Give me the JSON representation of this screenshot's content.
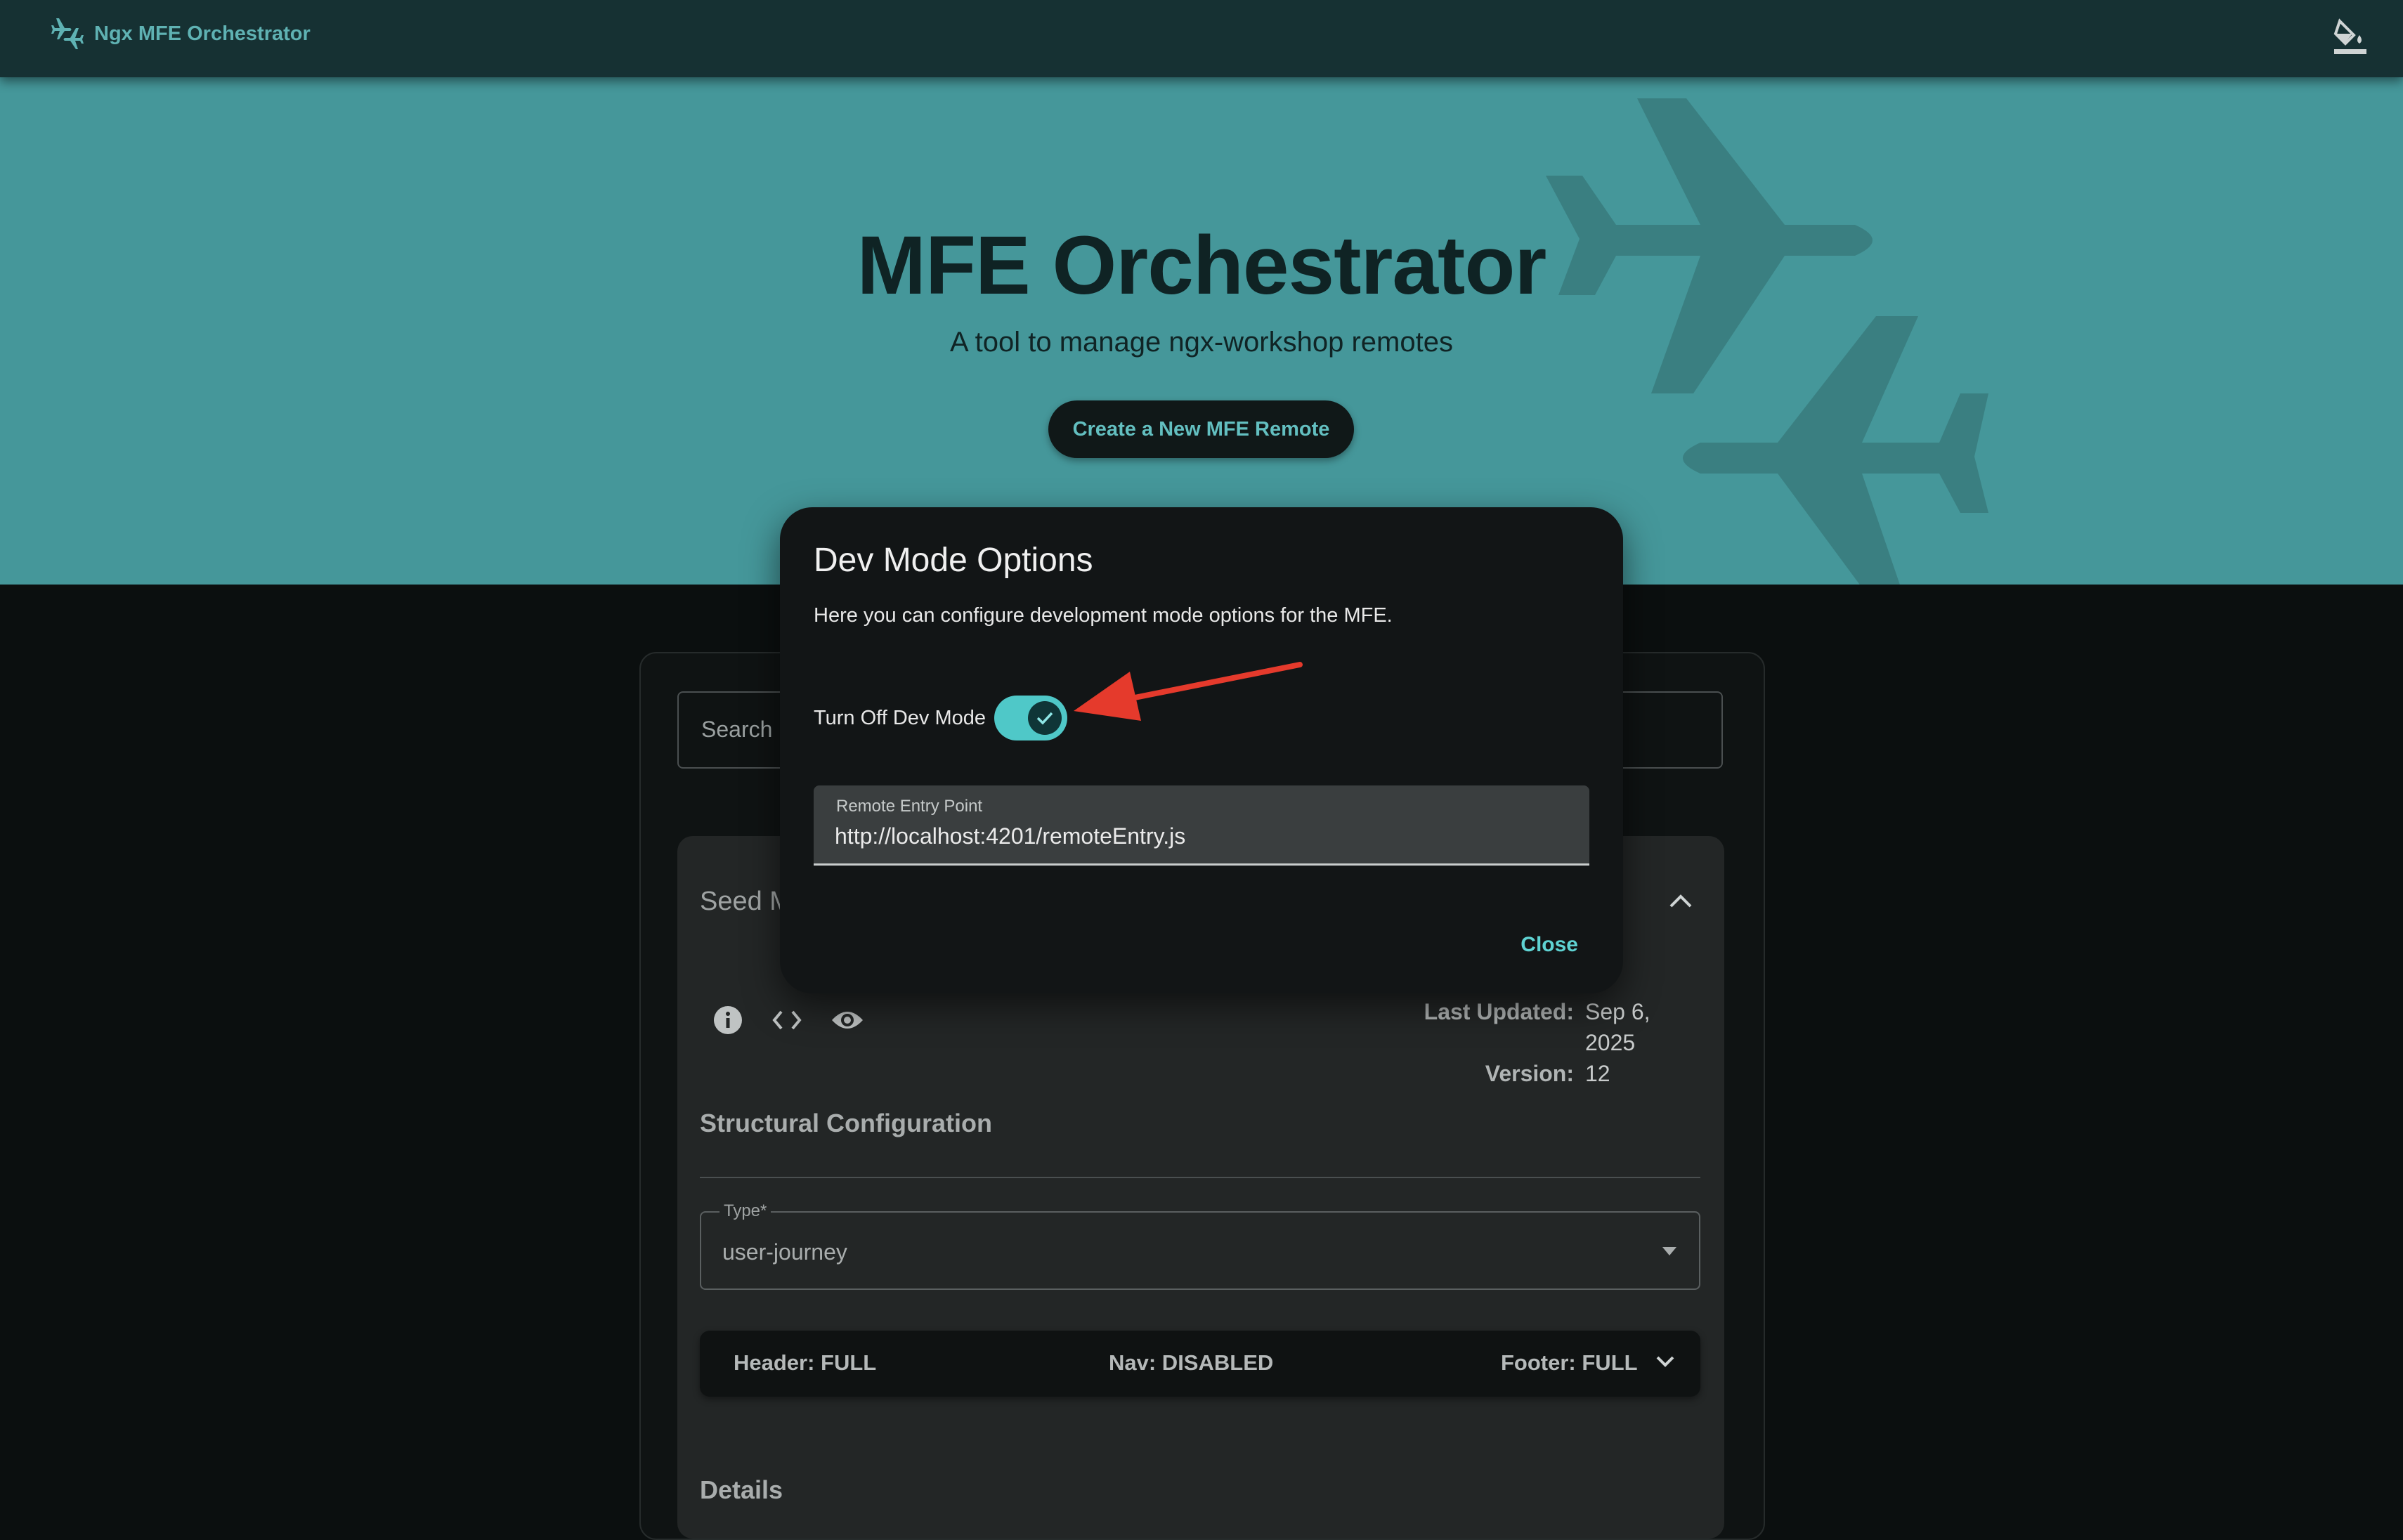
{
  "app": {
    "name": "Ngx MFE Orchestrator",
    "theme_icon": "format-paint-icon"
  },
  "hero": {
    "title": "MFE Orchestrator",
    "subtitle": "A tool to manage ngx-workshop remotes",
    "create_button": "Create a New MFE Remote"
  },
  "search": {
    "placeholder": "Search"
  },
  "card": {
    "title_visible": "Seed M",
    "last_updated_label": "Last Updated:",
    "last_updated_value": "Sep 6, 2025",
    "version_label": "Version:",
    "version_value": "12",
    "structural_title": "Structural Configuration",
    "type_label": "Type*",
    "type_value": "user-journey",
    "header": "Header: FULL",
    "nav": "Nav: DISABLED",
    "footer": "Footer: FULL",
    "details_title": "Details"
  },
  "dialog": {
    "title": "Dev Mode Options",
    "description": "Here you can configure development mode options for the MFE.",
    "toggle_label": "Turn Off Dev Mode",
    "toggle_checked": true,
    "entry_label": "Remote Entry Point",
    "entry_value": "http://localhost:4201/remoteEntry.js",
    "close": "Close"
  },
  "colors": {
    "hero": "#45979a",
    "topbar": "#163133",
    "accent": "#5fd3d3",
    "annotation": "#e53a2c"
  }
}
